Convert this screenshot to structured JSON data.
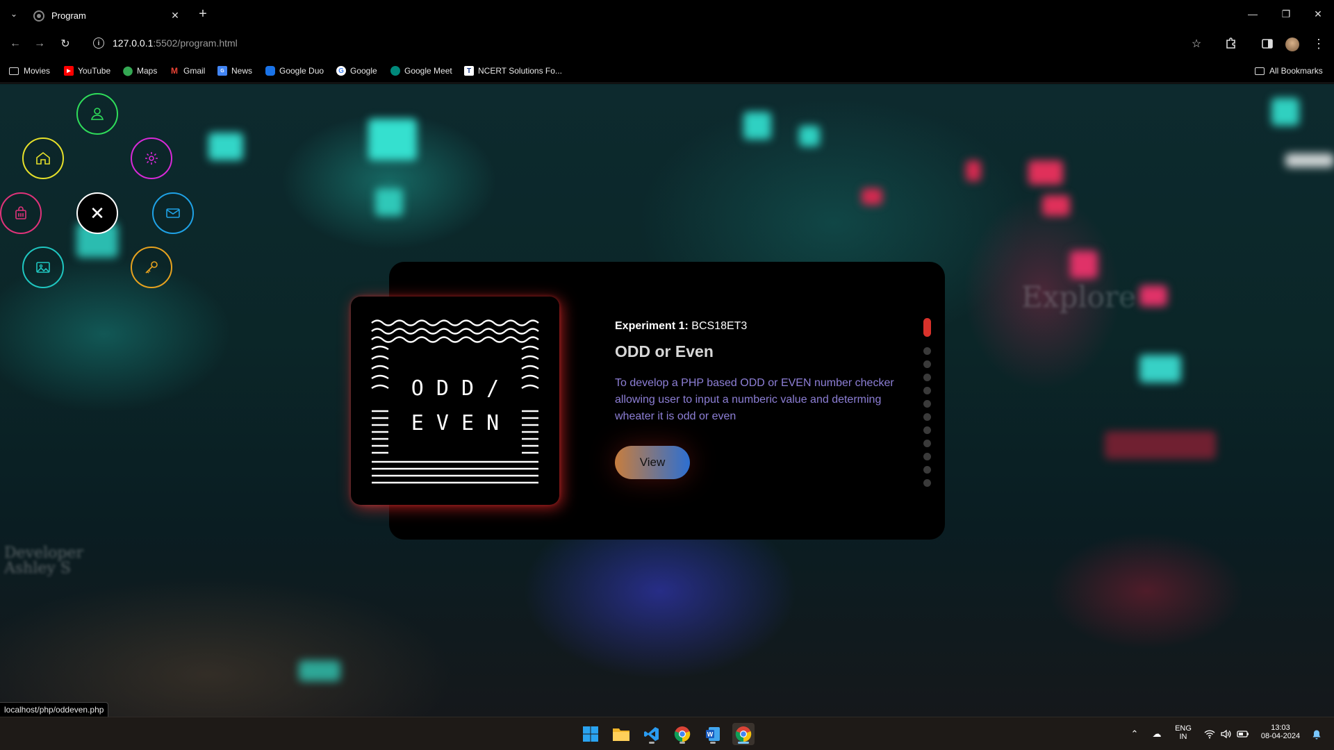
{
  "browser": {
    "tab_title": "Program",
    "url_host": "127.0.0.1",
    "url_path": ":5502/program.html",
    "bookmarks": [
      {
        "label": "Movies",
        "icon": "folder-icon"
      },
      {
        "label": "YouTube",
        "icon": "youtube-icon"
      },
      {
        "label": "Maps",
        "icon": "maps-icon"
      },
      {
        "label": "Gmail",
        "icon": "gmail-icon"
      },
      {
        "label": "News",
        "icon": "news-icon"
      },
      {
        "label": "Google Duo",
        "icon": "duo-icon"
      },
      {
        "label": "Google",
        "icon": "google-icon"
      },
      {
        "label": "Google Meet",
        "icon": "meet-icon"
      },
      {
        "label": "NCERT Solutions Fo...",
        "icon": "ncert-icon"
      }
    ],
    "all_bookmarks": "All Bookmarks",
    "status_url": "localhost/php/oddeven.php"
  },
  "menu": {
    "items": [
      {
        "name": "home",
        "color": "#e6e02a"
      },
      {
        "name": "user",
        "color": "#2fdc5a"
      },
      {
        "name": "settings",
        "color": "#d82ad8"
      },
      {
        "name": "shop",
        "color": "#e0337a"
      },
      {
        "name": "mail",
        "color": "#1fa2e6"
      },
      {
        "name": "image",
        "color": "#1fc6c0"
      },
      {
        "name": "key",
        "color": "#e6a21f"
      }
    ],
    "close_symbol": "✕"
  },
  "background": {
    "explore_text": "Explore",
    "watermark_line1": "Developer",
    "watermark_line2": "Ashley S"
  },
  "card": {
    "image_text_line1": "O D D  /",
    "image_text_line2": "E V E N",
    "experiment_label": "Experiment 1:",
    "experiment_code": "BCS18ET3",
    "title": "ODD or Even",
    "description": "To develop a PHP based ODD or EVEN number checker allowing user to input a numberic value and determing wheater it is odd or even",
    "button_label": "View",
    "pagination": {
      "total": 12,
      "active": 1
    }
  },
  "taskbar": {
    "language_line1": "ENG",
    "language_line2": "IN",
    "time": "13:03",
    "date": "08-04-2024"
  }
}
